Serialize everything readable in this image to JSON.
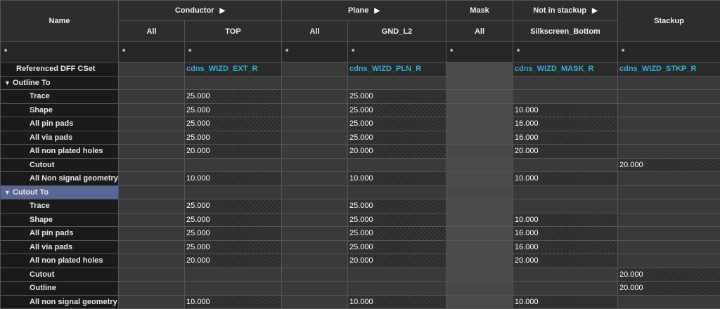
{
  "header": {
    "name": "Name",
    "conductor": "Conductor",
    "plane": "Plane",
    "mask": "Mask",
    "not_in_stackup": "Not in stackup",
    "stackup": "Stackup",
    "expand_icon": "triangle-right-icon",
    "sub": [
      "All",
      "TOP",
      "All",
      "GND_L2",
      "All",
      "Silkscreen_Bottom"
    ]
  },
  "filter": [
    "*",
    "*",
    "*",
    "*",
    "*",
    "*",
    "*",
    "*"
  ],
  "ref_row": {
    "label": "Referenced DFF CSet",
    "cells": [
      "",
      "cdns_WIZD_EXT_R",
      "",
      "cdns_WIZD_PLN_R",
      "",
      "cdns_WIZD_MASK_R",
      "cdns_WIZD_STKP_R"
    ]
  },
  "sections": [
    {
      "label": "Outline To",
      "collapse_icon": "triangle-down-icon",
      "selected": false,
      "rows": [
        {
          "label": "Trace",
          "cells": [
            "",
            "25.000",
            "",
            "25.000",
            "",
            "",
            ""
          ]
        },
        {
          "label": "Shape",
          "cells": [
            "",
            "25.000",
            "",
            "25.000",
            "",
            "10.000",
            ""
          ]
        },
        {
          "label": "All pin pads",
          "cells": [
            "",
            "25.000",
            "",
            "25.000",
            "",
            "16.000",
            ""
          ]
        },
        {
          "label": "All via pads",
          "cells": [
            "",
            "25.000",
            "",
            "25.000",
            "",
            "16.000",
            ""
          ]
        },
        {
          "label": "All non plated holes",
          "cells": [
            "",
            "20.000",
            "",
            "20.000",
            "",
            "20.000",
            ""
          ]
        },
        {
          "label": "Cutout",
          "cells": [
            "",
            "",
            "",
            "",
            "",
            "",
            "20.000"
          ]
        },
        {
          "label": "All Non signal geometry",
          "cells": [
            "",
            "10.000",
            "",
            "10.000",
            "",
            "10.000",
            ""
          ]
        }
      ]
    },
    {
      "label": "Cutout To",
      "collapse_icon": "triangle-down-icon",
      "selected": true,
      "rows": [
        {
          "label": "Trace",
          "cells": [
            "",
            "25.000",
            "",
            "25.000",
            "",
            "",
            ""
          ]
        },
        {
          "label": "Shape",
          "cells": [
            "",
            "25.000",
            "",
            "25.000",
            "",
            "10.000",
            ""
          ]
        },
        {
          "label": "All pin pads",
          "cells": [
            "",
            "25.000",
            "",
            "25.000",
            "",
            "16.000",
            ""
          ]
        },
        {
          "label": "All via pads",
          "cells": [
            "",
            "25.000",
            "",
            "25.000",
            "",
            "16.000",
            ""
          ]
        },
        {
          "label": "All non plated holes",
          "cells": [
            "",
            "20.000",
            "",
            "20.000",
            "",
            "20.000",
            ""
          ]
        },
        {
          "label": "Cutout",
          "cells": [
            "",
            "",
            "",
            "",
            "",
            "",
            "20.000"
          ]
        },
        {
          "label": "Outline",
          "cells": [
            "",
            "",
            "",
            "",
            "",
            "",
            "20.000"
          ]
        },
        {
          "label": "All non signal geometry",
          "cells": [
            "",
            "10.000",
            "",
            "10.000",
            "",
            "10.000",
            ""
          ]
        }
      ]
    }
  ]
}
